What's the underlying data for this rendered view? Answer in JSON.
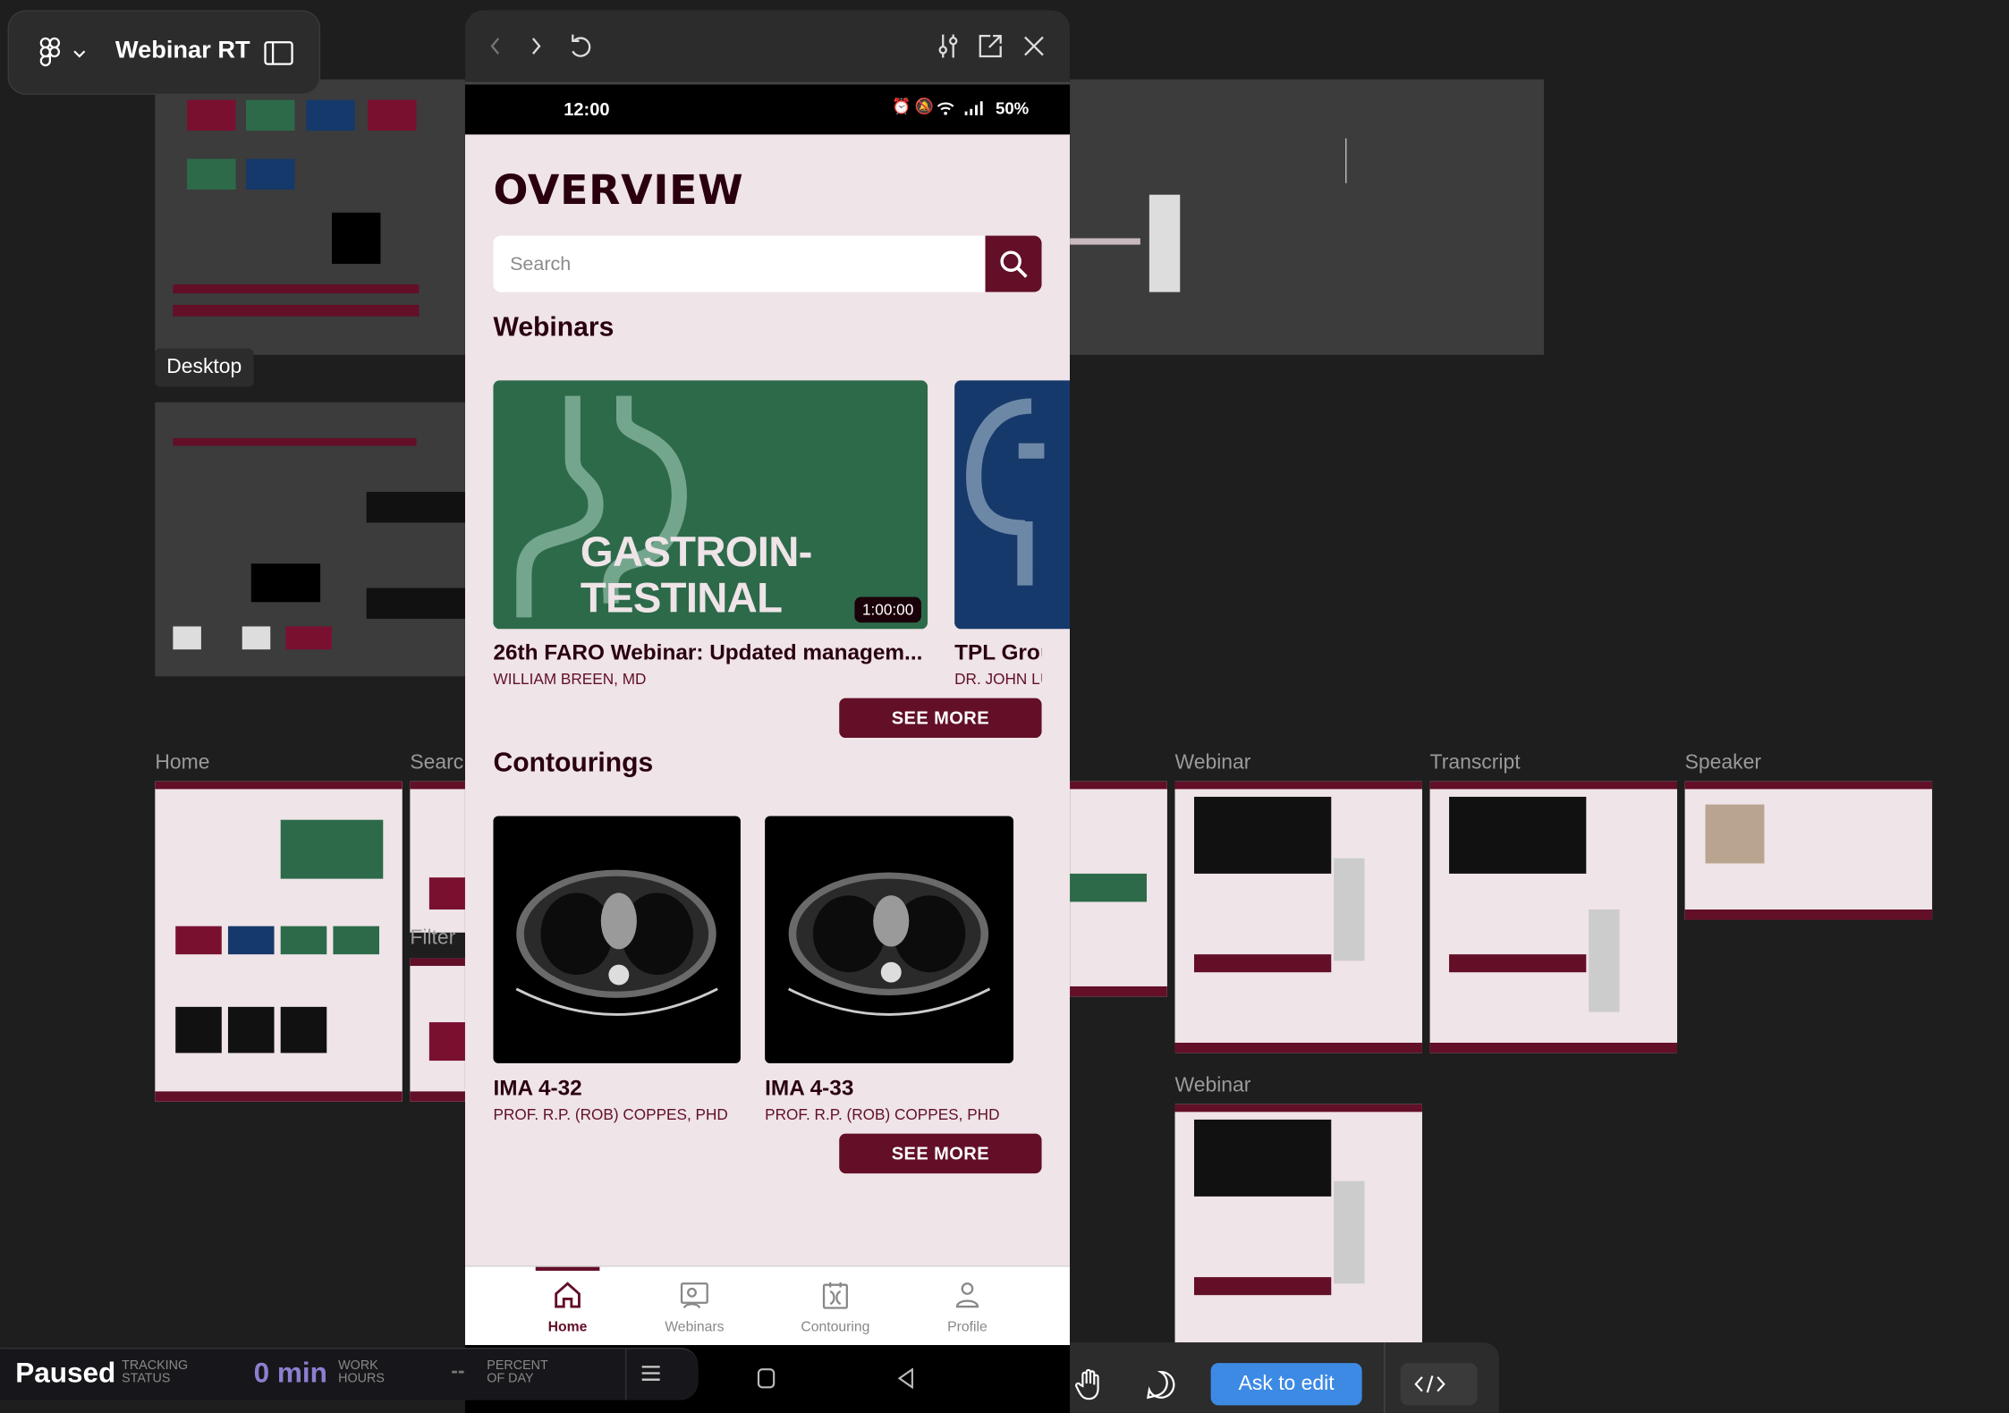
{
  "app": {
    "file_title": "Webinar RT",
    "icons": [
      "figma-logo-icon",
      "chevron-down-icon",
      "sidebar-toggle-icon"
    ]
  },
  "canvas": {
    "frame_labels": {
      "desktop": "Desktop",
      "home": "Home",
      "search": "Searc",
      "filter": "Filter",
      "webinar": "Webinar",
      "transcript": "Transcript",
      "speaker": "Speaker",
      "webinar2": "Webinar"
    }
  },
  "preview": {
    "toolbar_icons": [
      "back-icon",
      "forward-icon",
      "reload-icon",
      "tune-icon",
      "open-external-icon",
      "close-icon"
    ],
    "status_bar": {
      "time": "12:00",
      "battery": "50%"
    },
    "page_title": "OVERVIEW",
    "search": {
      "placeholder": "Search"
    },
    "webinars": {
      "heading": "Webinars",
      "items": [
        {
          "thumb_text_1": "GASTROIN-",
          "thumb_text_2": "TESTINAL",
          "duration": "1:00:00",
          "title": "26th FARO Webinar: Updated managem...",
          "author": "WILLIAM BREEN, MD",
          "color": "#2d6a4a"
        },
        {
          "title": "TPL Grou",
          "author": "DR. JOHN LU",
          "color": "#15396a"
        }
      ],
      "see_more": "SEE MORE"
    },
    "contourings": {
      "heading": "Contourings",
      "items": [
        {
          "title": "IMA 4-32",
          "author": "PROF. R.P. (ROB) COPPES, PHD"
        },
        {
          "title": "IMA 4-33",
          "author": "PROF. R.P. (ROB) COPPES, PHD"
        }
      ],
      "see_more": "SEE MORE"
    },
    "bottom_nav": [
      {
        "label": "Home",
        "active": true
      },
      {
        "label": "Webinars",
        "active": false
      },
      {
        "label": "Contouring",
        "active": false
      },
      {
        "label": "Profile",
        "active": false
      }
    ],
    "accent": "#620f27",
    "background": "#efe4e8"
  },
  "tracking": {
    "status": "Paused",
    "status_label_1": "TRACKING",
    "status_label_2": "STATUS",
    "hours": "0 min",
    "hours_label_1": "WORK",
    "hours_label_2": "HOURS",
    "percent": "--",
    "percent_label_1": "PERCENT",
    "percent_label_2": "OF DAY"
  },
  "right_toolbar": {
    "ask_to_edit": "Ask to edit",
    "icons": [
      "hand-icon",
      "comment-icon",
      "code-icon"
    ]
  }
}
